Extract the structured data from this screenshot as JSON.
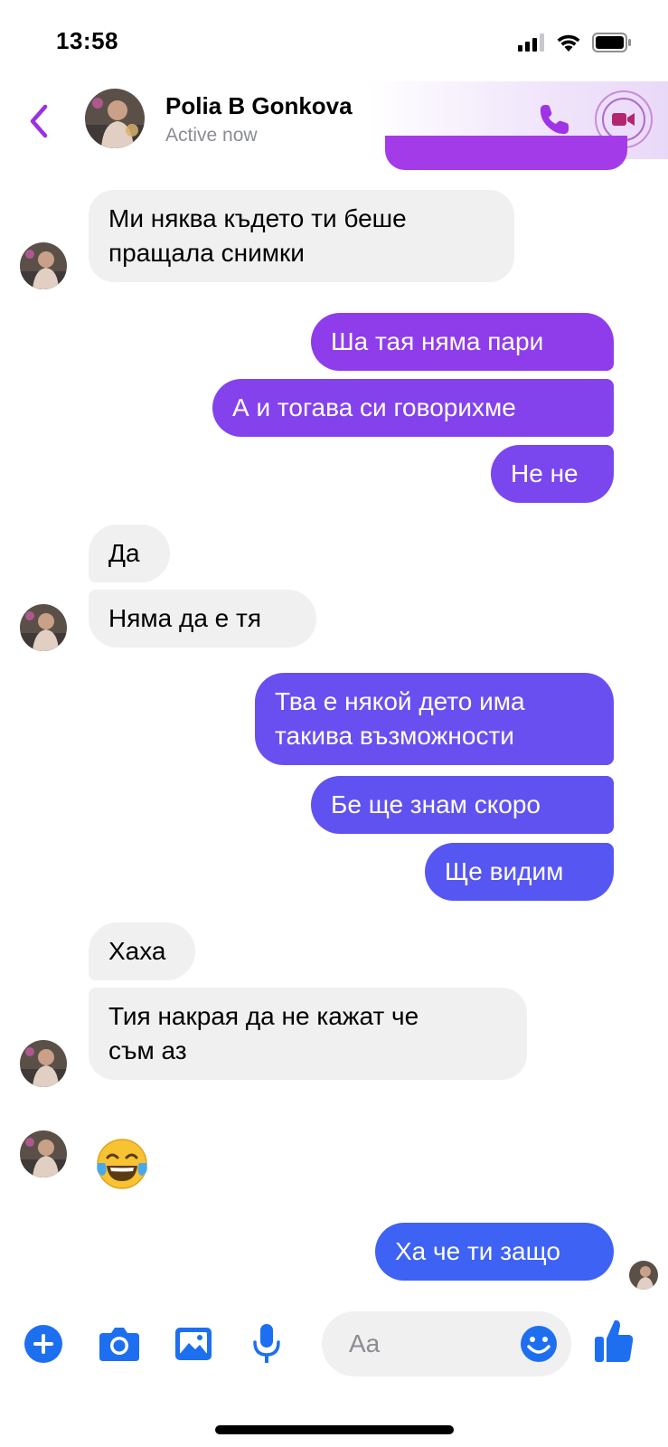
{
  "status_bar": {
    "time": "13:58"
  },
  "header": {
    "contact_name": "Polia B Gonkova",
    "contact_status": "Active now"
  },
  "colors": {
    "accent_purple": "#a033e6",
    "outgoing_gradient_start": "#9a3ae9",
    "outgoing_gradient_end": "#4a5cf2",
    "incoming_bg": "#f0f0f0",
    "composer_blue": "#1a73e8"
  },
  "messages": [
    {
      "side": "in",
      "text1": "Ми няква където ти беше",
      "text2": "пращала снимки"
    },
    {
      "side": "out",
      "text": "Ша тая няма пари"
    },
    {
      "side": "out",
      "text": "А и тогава си говорихме"
    },
    {
      "side": "out",
      "text": "Не не"
    },
    {
      "side": "in",
      "text": "Да"
    },
    {
      "side": "in",
      "text": "Няма да е тя"
    },
    {
      "side": "out",
      "text1": "Тва е някой дето има",
      "text2": "такива възможности"
    },
    {
      "side": "out",
      "text": "Бе ще знам скоро"
    },
    {
      "side": "out",
      "text": "Ще видим"
    },
    {
      "side": "in",
      "text": "Хаха"
    },
    {
      "side": "in",
      "text1": "Тия накрая да не кажат че",
      "text2": "съм аз"
    },
    {
      "side": "in",
      "emoji": "face-with-tears-of-joy"
    },
    {
      "side": "out",
      "text": "Ха че ти защо"
    }
  ],
  "composer": {
    "placeholder": "Aa",
    "icons": [
      "plus-icon",
      "camera-icon",
      "gallery-icon",
      "microphone-icon",
      "emoji-icon",
      "thumbs-up-icon"
    ]
  }
}
